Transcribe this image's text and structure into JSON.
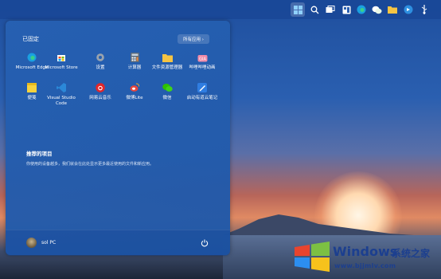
{
  "start_menu": {
    "pinned_title": "已固定",
    "all_apps_label": "所有应用  ›",
    "apps": [
      {
        "label": "Microsoft Edge",
        "icon": "edge-icon",
        "color": "#1aa0e0"
      },
      {
        "label": "Microsoft Store",
        "icon": "store-icon",
        "color": "#f3f3f3"
      },
      {
        "label": "设置",
        "icon": "settings-icon",
        "color": "#9aa3ad"
      },
      {
        "label": "计算器",
        "icon": "calculator-icon",
        "color": "#5b6b7d"
      },
      {
        "label": "文件资源管理器",
        "icon": "folder-icon",
        "color": "#f5c443"
      },
      {
        "label": "哔哩哔哩动画",
        "icon": "bilibili-icon",
        "color": "#f08aa8"
      },
      {
        "label": "便笺",
        "icon": "sticky-notes-icon",
        "color": "#f7d23e"
      },
      {
        "label": "Visual Studio Code",
        "icon": "vscode-icon",
        "color": "#2b88d8"
      },
      {
        "label": "网易云音乐",
        "icon": "netease-music-icon",
        "color": "#e0262b"
      },
      {
        "label": "微博Lite",
        "icon": "weibo-icon",
        "color": "#e8463c"
      },
      {
        "label": "微信",
        "icon": "wechat-icon",
        "color": "#2dc100"
      },
      {
        "label": "启动有道云笔记",
        "icon": "youdao-note-icon",
        "color": "#2f7de1"
      }
    ],
    "recommended_title": "推荐的项目",
    "recommended_desc": "你使用的设备越多，我们就会在此处显示更多最近使用的文件和新应用。",
    "user_name": "sol PC"
  },
  "watermark": {
    "brand": "Windows",
    "brand_cn": "系统之家",
    "url": "www.bjjmlv.com"
  }
}
